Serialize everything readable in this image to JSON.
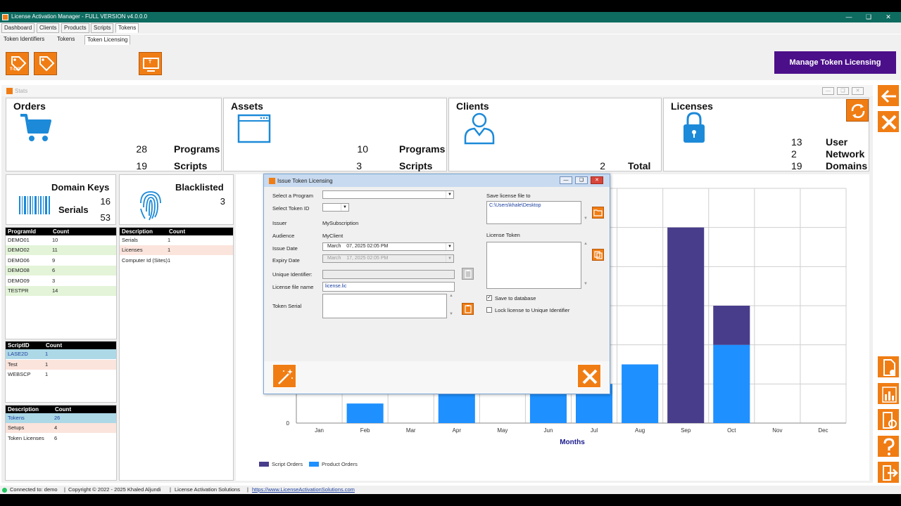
{
  "window": {
    "title": "License Activation Manager - FULL VERSION v4.0.0.0"
  },
  "menu_tabs": [
    {
      "label": "Dashboard"
    },
    {
      "label": "Clients"
    },
    {
      "label": "Products"
    },
    {
      "label": "Scripts"
    },
    {
      "label": "Tokens"
    }
  ],
  "sub_tabs": [
    {
      "label": "Token Identifiers"
    },
    {
      "label": "Tokens"
    },
    {
      "label": "Token Licensing"
    }
  ],
  "toolbar": {
    "btn1_badge": "T-LIC",
    "btn3_badge": "T",
    "manage_label": "Manage Token Licensing"
  },
  "stats": {
    "title": "Stats"
  },
  "orders": {
    "title": "Orders",
    "programs_count": "28",
    "programs_label": "Programs",
    "scripts_count": "19",
    "scripts_label": "Scripts"
  },
  "assets": {
    "title": "Assets",
    "programs_count": "10",
    "programs_label": "Programs",
    "scripts_count": "3",
    "scripts_label": "Scripts"
  },
  "clients": {
    "title": "Clients",
    "total_count": "2",
    "total_label": "Total"
  },
  "licenses": {
    "title": "Licenses",
    "user_count": "13",
    "user_label": "User",
    "network_count": "2",
    "network_label": "Network",
    "domains_count": "19",
    "domains_label": "Domains"
  },
  "domain_keys": {
    "title": "Domain Keys",
    "count": "16",
    "serials_label": "Serials",
    "serials_count": "53"
  },
  "blacklisted": {
    "title": "Blacklisted",
    "count": "3"
  },
  "programs_table": {
    "col1": "ProgramId",
    "col2": "Count",
    "rows": [
      {
        "id": "DEMO01",
        "count": "10"
      },
      {
        "id": "DEMO02",
        "count": "11"
      },
      {
        "id": "DEMO06",
        "count": "9"
      },
      {
        "id": "DEMO08",
        "count": "6"
      },
      {
        "id": "DEMO09",
        "count": "3"
      },
      {
        "id": "TESTPR",
        "count": "14"
      }
    ]
  },
  "scripts_table": {
    "col1": "ScriptID",
    "col2": "Count",
    "rows": [
      {
        "id": "LASE2D",
        "count": "1"
      },
      {
        "id": "Test",
        "count": "1"
      },
      {
        "id": "WEBSCP",
        "count": "1"
      }
    ]
  },
  "tokens_table": {
    "col1": "Description",
    "col2": "Count",
    "rows": [
      {
        "id": "Tokens",
        "count": "26"
      },
      {
        "id": "Setups",
        "count": "4"
      },
      {
        "id": "Token Licenses",
        "count": "6"
      }
    ]
  },
  "blacklist_table": {
    "col1": "Description",
    "col2": "Count",
    "rows": [
      {
        "id": "Serials",
        "count": "1"
      },
      {
        "id": "Licenses",
        "count": "1"
      },
      {
        "id": "Computer Id (Sites)",
        "count": "1"
      }
    ]
  },
  "dialog": {
    "title": "Issue Token Licensing",
    "select_program_label": "Select a Program",
    "select_program_value": "",
    "select_token_label": "Select Token ID",
    "select_token_value": "",
    "issuer_label": "Issuer",
    "issuer_value": "MySubscription",
    "audience_label": "Audience",
    "audience_value": "MyClient",
    "issue_date_label": "Issue Date",
    "issue_date_value": "March    07, 2025 02:05 PM",
    "expiry_date_label": "Expiry Date",
    "expiry_date_value": "March    17, 2025 02:05 PM",
    "unique_id_label": "Unique Identifier:",
    "unique_id_value": "",
    "license_file_label": "License file name",
    "license_file_value": "license.lic",
    "token_serial_label": "Token Serial",
    "token_serial_value": "",
    "save_file_label": "Save license file to",
    "save_file_value": "C:\\Users\\khale\\Desktop",
    "license_token_label": "License Token",
    "license_token_value": "",
    "save_db_label": "Save to database",
    "save_db_checked": true,
    "lock_label": "Lock license to Unique Identifier",
    "lock_checked": false
  },
  "chart_data": {
    "type": "bar",
    "stacked": true,
    "categories": [
      "Jan",
      "Feb",
      "Mar",
      "Apr",
      "May",
      "Jun",
      "Jul",
      "Aug",
      "Sep",
      "Oct",
      "Nov",
      "Dec"
    ],
    "series": [
      {
        "name": "Product Orders",
        "color": "#1e90ff",
        "values": [
          0,
          1,
          0,
          2,
          0,
          2,
          2,
          3,
          0,
          4,
          0,
          0
        ]
      },
      {
        "name": "Script Orders",
        "color": "#483d8b",
        "values": [
          0,
          0,
          0,
          0,
          0,
          0,
          0,
          0,
          10,
          2,
          0,
          0
        ]
      }
    ],
    "xlabel": "Months",
    "ylabel": "",
    "ylim": [
      0,
      12
    ],
    "y_tick_label": "0",
    "grid": true,
    "legend": "bottom-left"
  },
  "status": {
    "connected": "Connected to: demo",
    "sep1": "|",
    "copyright": "Copyright © 2022 - 2025 Khaled Aljundi",
    "sep2": "|",
    "company": "License Activation Solutions",
    "sep3": "|",
    "url": "https://www.LicenseActivationSolutions.com"
  },
  "icons": {
    "accent": "#f07d14",
    "blue": "#1c8ad8",
    "purple": "#4b0f8a"
  }
}
